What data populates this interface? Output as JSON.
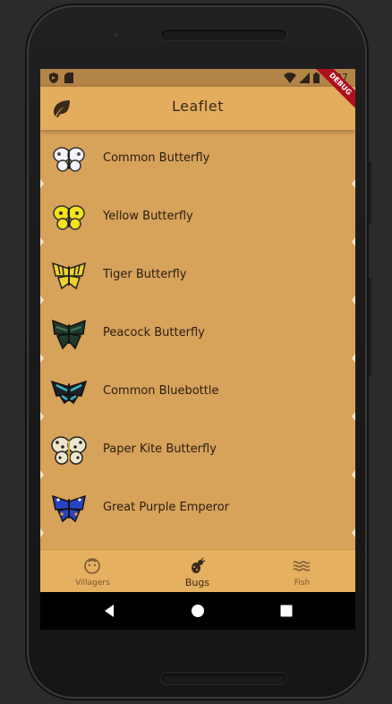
{
  "status_bar": {
    "time": "27",
    "debug_banner": "DEBUG"
  },
  "app_bar": {
    "title": "Leaflet",
    "logo_icon": "leaf-icon"
  },
  "bugs": [
    {
      "name": "Common Butterfly",
      "icon": "white-butterfly"
    },
    {
      "name": "Yellow Butterfly",
      "icon": "yellow-butterfly"
    },
    {
      "name": "Tiger Butterfly",
      "icon": "tiger-butterfly"
    },
    {
      "name": "Peacock Butterfly",
      "icon": "peacock-butterfly"
    },
    {
      "name": "Common Bluebottle",
      "icon": "bluebottle-butterfly"
    },
    {
      "name": "Paper Kite Butterfly",
      "icon": "paperkite-butterfly"
    },
    {
      "name": "Great Purple Emperor",
      "icon": "purple-emperor-butterfly"
    }
  ],
  "bottom_nav": {
    "items": [
      {
        "label": "Villagers",
        "icon": "face-icon",
        "active": false
      },
      {
        "label": "Bugs",
        "icon": "bug-icon",
        "active": true
      },
      {
        "label": "Fish",
        "icon": "waves-icon",
        "active": false
      }
    ]
  },
  "colors": {
    "app_bar": "#e3ad5d",
    "list_background": "#d7a25a",
    "status_bar": "#b38447",
    "text_primary": "#2a1e12"
  }
}
